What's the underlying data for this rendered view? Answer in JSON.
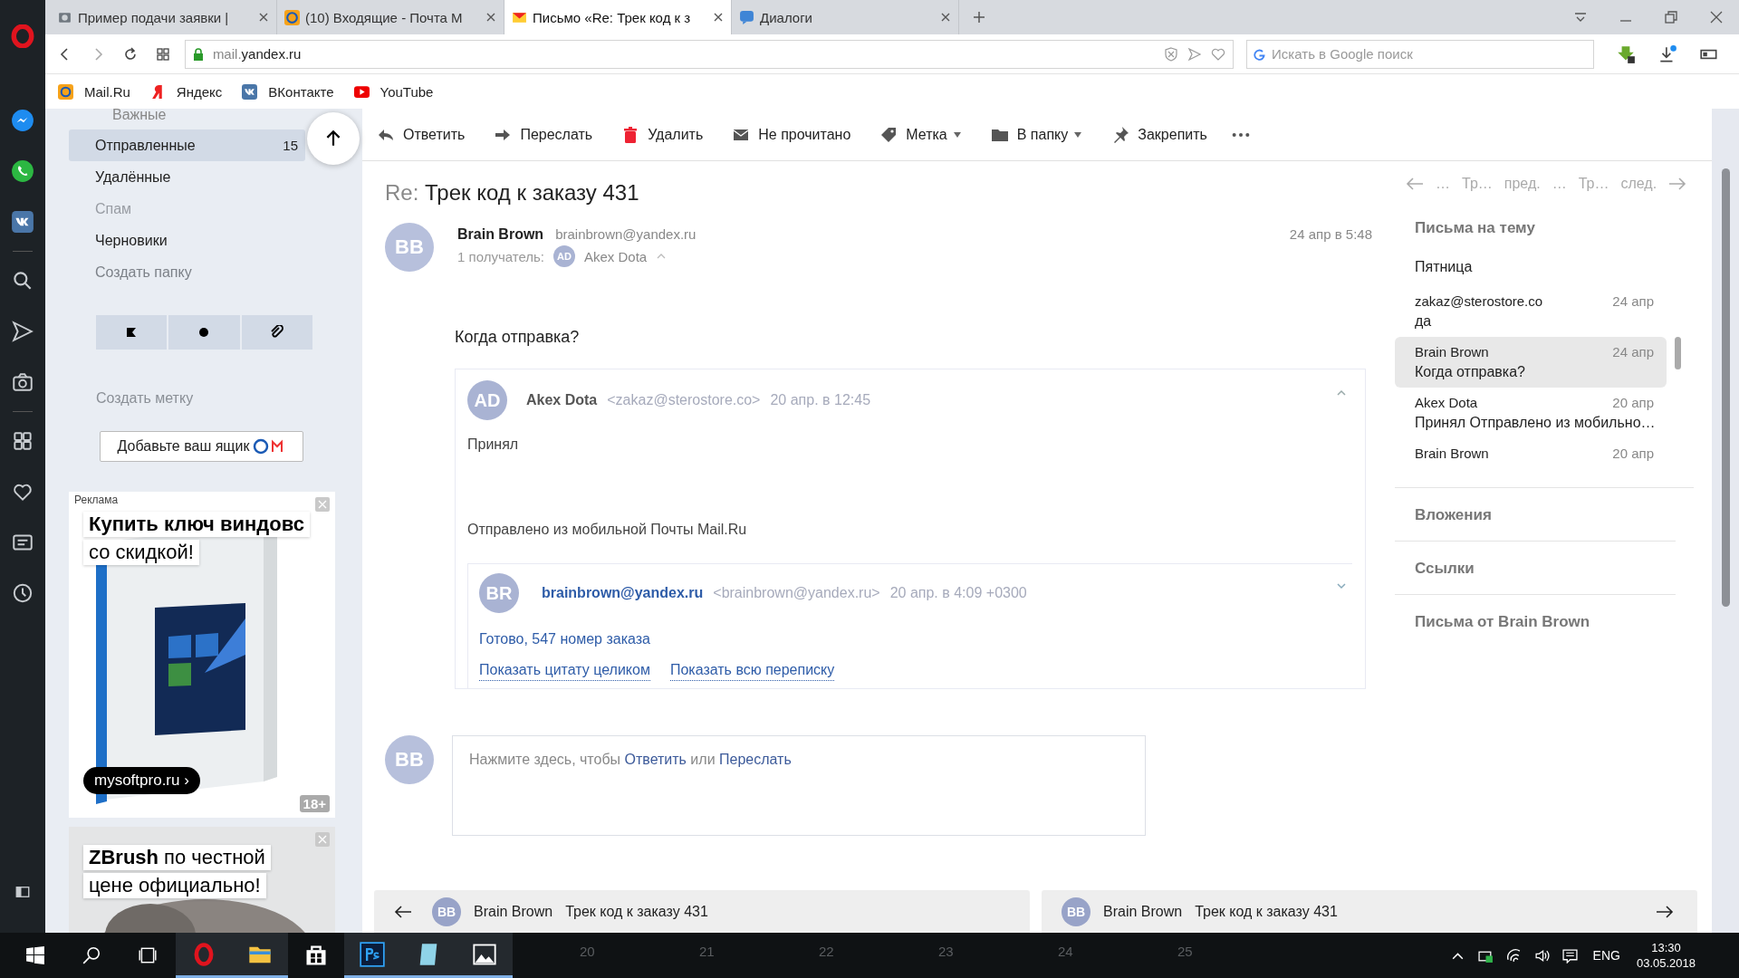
{
  "browser": {
    "tabs": [
      {
        "kind": "page",
        "title": "Пример подачи заявки |",
        "selected": false
      },
      {
        "kind": "mailru",
        "title": "(10) Входящие - Почта М",
        "selected": false
      },
      {
        "kind": "mail",
        "title": "Письмо «Re: Трек код к з",
        "selected": true
      },
      {
        "kind": "chat",
        "title": "Диалоги",
        "selected": false
      }
    ],
    "address": {
      "subdomain": "mail.",
      "domain": "yandex.ru",
      "secure": true
    },
    "search": {
      "placeholder": "Искать в Google поиск"
    },
    "bookmarks": [
      {
        "kind": "mailru",
        "label": "Mail.Ru"
      },
      {
        "kind": "yandex",
        "label": "Яндекс"
      },
      {
        "kind": "vk",
        "label": "ВКонтакте"
      },
      {
        "kind": "youtube",
        "label": "YouTube"
      }
    ]
  },
  "mail_sidebar": {
    "partial_folder": "Важные",
    "folders": [
      {
        "kind": "folder",
        "label": "Отправленные",
        "count": "15",
        "empty": false,
        "selected": true
      },
      {
        "kind": "folder",
        "label": "Удалённые",
        "empty": false,
        "selected": false
      },
      {
        "kind": "folder",
        "label": "Спам",
        "empty": true,
        "selected": false
      },
      {
        "kind": "folder",
        "label": "Черновики",
        "empty": false,
        "selected": false
      },
      {
        "kind": "action",
        "label": "Создать папку",
        "empty": false,
        "selected": false
      }
    ],
    "create_label": "Создать метку",
    "add_mailbox": "Добавьте ваш ящик",
    "ads": [
      {
        "kind": "windows",
        "tag": "Реклама",
        "lines": [
          "**Купить ключ виндовс**",
          "со скидкой!"
        ],
        "link": "mysoftpro.ru ›",
        "age": "18+"
      },
      {
        "kind": "zbrush",
        "lines": [
          "**ZBrush** по честной",
          "цене официально!"
        ]
      }
    ]
  },
  "message": {
    "toolbar": [
      {
        "kind": "reply",
        "label": "Ответить",
        "dropdown": false
      },
      {
        "kind": "forward",
        "label": "Переслать",
        "dropdown": false
      },
      {
        "kind": "delete",
        "label": "Удалить",
        "dropdown": false
      },
      {
        "kind": "unread",
        "label": "Не прочитано",
        "dropdown": false
      },
      {
        "kind": "label",
        "label": "Метка",
        "dropdown": true
      },
      {
        "kind": "folder",
        "label": "В папку",
        "dropdown": true
      },
      {
        "kind": "pin",
        "label": "Закрепить",
        "dropdown": false
      }
    ],
    "subject_prefix": "Re:",
    "subject": "Трек код к заказу 431",
    "sender": {
      "initials": "BB",
      "name": "Brain Brown",
      "email": "brainbrown@yandex.ru",
      "date": "24 апр в 5:48",
      "recipients_label": "1 получатель:",
      "recipient_initials": "AD",
      "recipient": "Akex Dota"
    },
    "body": "Когда отправка?",
    "quote": {
      "initials": "AD",
      "name": "Akex Dota",
      "email": "<zakaz@sterostore.co>",
      "date": "20 апр. в 12:45",
      "expanded": true,
      "lines": [
        "Принял",
        "Отправлено из мобильной Почты Mail.Ru"
      ],
      "nested": {
        "initials": "BR",
        "name": "brainbrown@yandex.ru",
        "email": "<brainbrown@yandex.ru>",
        "date": "20 апр. в 4:09 +0300",
        "expanded": false,
        "text": "Готово, 547 номер заказа",
        "links": [
          "Показать цитату целиком",
          "Показать всю переписку"
        ]
      }
    },
    "reply": {
      "initials": "BB",
      "prompt": "Нажмите здесь, чтобы",
      "reply_link": "Ответить",
      "joiner": "или",
      "forward_link": "Переслать"
    },
    "bottom_nav": [
      {
        "kind": "prev",
        "initials": "BB",
        "name": "Brain Brown",
        "subject": "Трек код к заказу 431"
      },
      {
        "kind": "next",
        "initials": "BB",
        "name": "Brain Brown",
        "subject": "Трек код к заказу 431"
      }
    ]
  },
  "thread_panel": {
    "prev": {
      "ellipsis": "…",
      "subject": "Тр…",
      "label": "пред."
    },
    "next": {
      "ellipsis": "…",
      "subject": "Тр…",
      "label": "след."
    },
    "title": "Письма на тему",
    "group": "Пятница",
    "items": [
      {
        "from": "zakaz@sterostore.co",
        "date": "24 апр",
        "text": "да",
        "selected": false
      },
      {
        "from": "Brain Brown",
        "date": "24 апр",
        "text": "Когда отправка?",
        "selected": true
      },
      {
        "from": "Akex Dota",
        "date": "20 апр",
        "text": "Принял Отправлено из мобильно…",
        "selected": false
      },
      {
        "from": "Brain Brown",
        "date": "20 апр",
        "selected": false
      }
    ],
    "sections": [
      "Вложения",
      "Ссылки",
      "Письма от Brain Brown"
    ]
  },
  "taskbar": {
    "apps": [
      {
        "kind": "opera",
        "active": true
      },
      {
        "kind": "explorer",
        "active": true
      },
      {
        "kind": "store",
        "active": false
      },
      {
        "kind": "photoshop",
        "active": true
      },
      {
        "kind": "notes",
        "active": true
      },
      {
        "kind": "photos",
        "active": true
      }
    ],
    "backdrop_numbers": [
      "20",
      "21",
      "22",
      "23",
      "24",
      "25"
    ],
    "language": "ENG",
    "time": "13:30",
    "date": "03.05.2018"
  }
}
